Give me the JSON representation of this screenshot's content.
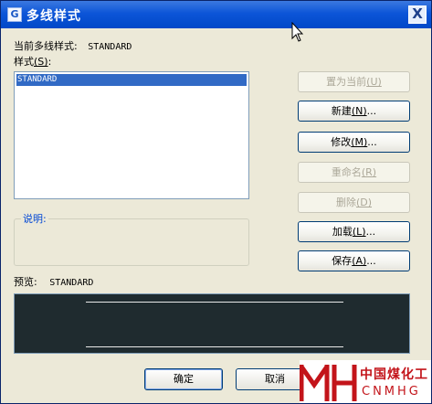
{
  "window": {
    "title": "多线样式",
    "close_label": "X"
  },
  "current_style": {
    "label": "当前多线样式:",
    "value": "STANDARD"
  },
  "styles": {
    "label": "样式",
    "accel": "(S)",
    "colon": ":",
    "items": [
      "STANDARD"
    ]
  },
  "description": {
    "caption": "说明:"
  },
  "buttons": {
    "set_current": {
      "label": "置为当前",
      "accel": "(U)",
      "disabled": true
    },
    "new": {
      "label": "新建",
      "accel": "(N)",
      "suffix": "...",
      "disabled": false
    },
    "modify": {
      "label": "修改",
      "accel": "(M)",
      "suffix": "...",
      "disabled": false
    },
    "rename": {
      "label": "重命名",
      "accel": "(R)",
      "disabled": true
    },
    "delete": {
      "label": "删除",
      "accel": "(D)",
      "disabled": true
    },
    "load": {
      "label": "加载",
      "accel": "(L)",
      "suffix": "...",
      "disabled": false
    },
    "save": {
      "label": "保存",
      "accel": "(A)",
      "suffix": "...",
      "disabled": false
    }
  },
  "preview": {
    "label": "预览:",
    "value": "STANDARD"
  },
  "footer": {
    "ok_label": "确定",
    "cancel_label": "取消"
  },
  "watermark": {
    "cn_text": "中国煤化工",
    "en_text": "CNMHG"
  },
  "colors": {
    "titlebar": "#0c55d8",
    "selection": "#316ac5",
    "preview_bg": "#1f2b2f",
    "watermark_red": "#c3141a"
  }
}
